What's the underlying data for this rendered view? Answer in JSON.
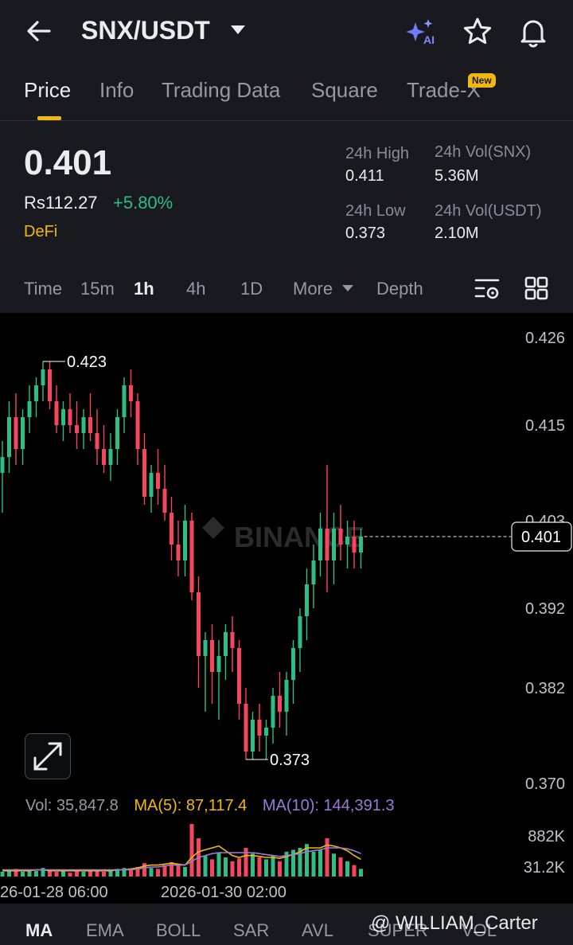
{
  "header": {
    "pair": "SNX/USDT",
    "icons": [
      "back-arrow-icon",
      "ai-sparkle-icon",
      "star-icon",
      "bell-icon"
    ]
  },
  "tabs": [
    {
      "label": "Price",
      "active": true
    },
    {
      "label": "Info"
    },
    {
      "label": "Trading Data"
    },
    {
      "label": "Square"
    },
    {
      "label": "Trade-X",
      "badge": "New"
    }
  ],
  "ticker": {
    "price": "0.401",
    "fiat_price": "Rs112.27",
    "change": "+5.80%",
    "tag": "DeFi",
    "high_label": "24h High",
    "high": "0.411",
    "low_label": "24h Low",
    "low": "0.373",
    "vol_base_label": "24h Vol(SNX)",
    "vol_base": "5.36M",
    "vol_quote_label": "24h Vol(USDT)",
    "vol_quote": "2.10M"
  },
  "timeframes": {
    "items": [
      "Time",
      "15m",
      "1h",
      "4h",
      "1D",
      "More",
      "Depth"
    ],
    "active": "1h"
  },
  "chart_data": {
    "type": "candlestick",
    "pair": "SNX/USDT",
    "interval": "1h",
    "watermark": "BINANCE",
    "y_ticks": [
      "0.426",
      "0.415",
      "0.403",
      "0.392",
      "0.382",
      "0.370"
    ],
    "current_price_label": "0.401",
    "high_marker": "0.423",
    "low_marker": "0.373",
    "x_ticks": [
      "26-01-28 06:00",
      "2026-01-30 02:00"
    ],
    "volume_ticks": [
      "882K",
      "31.2K"
    ],
    "volume_info": {
      "vol": "Vol: 35,847.8",
      "ma5": "MA(5): 87,117.4",
      "ma10": "MA(10): 144,391.3"
    },
    "colors": {
      "up": "#2ebd85",
      "down": "#f6465d",
      "ma5": "#f0b90b",
      "ma10": "#9c7ad6"
    },
    "candles": [
      [
        0.409,
        0.413,
        0.404,
        0.411
      ],
      [
        0.411,
        0.418,
        0.409,
        0.416
      ],
      [
        0.416,
        0.419,
        0.41,
        0.412
      ],
      [
        0.412,
        0.417,
        0.41,
        0.416
      ],
      [
        0.416,
        0.42,
        0.414,
        0.418
      ],
      [
        0.418,
        0.421,
        0.416,
        0.42
      ],
      [
        0.42,
        0.423,
        0.418,
        0.422
      ],
      [
        0.422,
        0.423,
        0.417,
        0.418
      ],
      [
        0.418,
        0.42,
        0.414,
        0.415
      ],
      [
        0.415,
        0.418,
        0.413,
        0.417
      ],
      [
        0.417,
        0.419,
        0.414,
        0.415
      ],
      [
        0.415,
        0.418,
        0.412,
        0.414
      ],
      [
        0.414,
        0.417,
        0.412,
        0.416
      ],
      [
        0.416,
        0.419,
        0.413,
        0.414
      ],
      [
        0.414,
        0.417,
        0.41,
        0.412
      ],
      [
        0.412,
        0.415,
        0.409,
        0.41
      ],
      [
        0.41,
        0.414,
        0.408,
        0.412
      ],
      [
        0.412,
        0.417,
        0.41,
        0.416
      ],
      [
        0.416,
        0.421,
        0.414,
        0.42
      ],
      [
        0.42,
        0.422,
        0.416,
        0.418
      ],
      [
        0.418,
        0.419,
        0.41,
        0.412
      ],
      [
        0.412,
        0.414,
        0.405,
        0.406
      ],
      [
        0.406,
        0.41,
        0.404,
        0.409
      ],
      [
        0.409,
        0.412,
        0.405,
        0.407
      ],
      [
        0.407,
        0.41,
        0.403,
        0.404
      ],
      [
        0.404,
        0.406,
        0.398,
        0.4
      ],
      [
        0.4,
        0.403,
        0.396,
        0.398
      ],
      [
        0.398,
        0.405,
        0.396,
        0.403
      ],
      [
        0.403,
        0.404,
        0.393,
        0.394
      ],
      [
        0.394,
        0.396,
        0.382,
        0.386
      ],
      [
        0.386,
        0.389,
        0.379,
        0.388
      ],
      [
        0.388,
        0.39,
        0.38,
        0.384
      ],
      [
        0.384,
        0.388,
        0.378,
        0.386
      ],
      [
        0.386,
        0.39,
        0.383,
        0.389
      ],
      [
        0.389,
        0.391,
        0.384,
        0.387
      ],
      [
        0.387,
        0.388,
        0.378,
        0.38
      ],
      [
        0.38,
        0.382,
        0.373,
        0.374
      ],
      [
        0.374,
        0.379,
        0.373,
        0.378
      ],
      [
        0.378,
        0.38,
        0.374,
        0.376
      ],
      [
        0.376,
        0.378,
        0.373,
        0.377
      ],
      [
        0.377,
        0.382,
        0.375,
        0.381
      ],
      [
        0.381,
        0.384,
        0.377,
        0.379
      ],
      [
        0.379,
        0.384,
        0.376,
        0.383
      ],
      [
        0.383,
        0.388,
        0.38,
        0.387
      ],
      [
        0.387,
        0.392,
        0.384,
        0.391
      ],
      [
        0.391,
        0.397,
        0.388,
        0.395
      ],
      [
        0.395,
        0.4,
        0.392,
        0.398
      ],
      [
        0.398,
        0.404,
        0.396,
        0.402
      ],
      [
        0.402,
        0.41,
        0.394,
        0.398
      ],
      [
        0.398,
        0.404,
        0.395,
        0.402
      ],
      [
        0.402,
        0.405,
        0.398,
        0.4
      ],
      [
        0.4,
        0.403,
        0.397,
        0.401
      ],
      [
        0.401,
        0.403,
        0.397,
        0.399
      ],
      [
        0.399,
        0.402,
        0.397,
        0.401
      ]
    ],
    "volumes": [
      5,
      6,
      8,
      5,
      7,
      6,
      9,
      7,
      5,
      6,
      4,
      6,
      5,
      7,
      6,
      5,
      6,
      8,
      9,
      7,
      10,
      14,
      9,
      8,
      12,
      15,
      13,
      10,
      55,
      40,
      22,
      18,
      25,
      20,
      16,
      19,
      30,
      24,
      20,
      18,
      22,
      16,
      26,
      28,
      30,
      34,
      26,
      28,
      40,
      24,
      20,
      16,
      12,
      8
    ],
    "ma5_line": [
      6,
      6,
      6,
      6,
      6,
      7,
      7,
      6,
      6,
      6,
      6,
      6,
      6,
      6,
      6,
      6,
      6,
      7,
      7,
      8,
      9,
      11,
      12,
      12,
      13,
      14,
      13,
      12,
      20,
      26,
      28,
      30,
      32,
      27,
      22,
      20,
      22,
      22,
      21,
      20,
      20,
      19,
      21,
      23,
      26,
      30,
      30,
      30,
      33,
      32,
      30,
      27,
      22,
      18
    ],
    "ma10_line": [
      7,
      7,
      7,
      7,
      7,
      7,
      7,
      7,
      7,
      7,
      7,
      7,
      7,
      7,
      7,
      7,
      7,
      7,
      7,
      7,
      8,
      9,
      10,
      10,
      11,
      12,
      12,
      12,
      16,
      20,
      22,
      24,
      25,
      25,
      25,
      25,
      25,
      25,
      24,
      23,
      22,
      21,
      22,
      23,
      24,
      26,
      27,
      28,
      30,
      30,
      30,
      29,
      27,
      24
    ]
  },
  "indicators": {
    "items": [
      "MA",
      "EMA",
      "BOLL",
      "SAR",
      "AVL",
      "SUPER",
      "VOL"
    ],
    "active": "MA"
  },
  "watermark_user": "@ WILLIAM_Carter"
}
